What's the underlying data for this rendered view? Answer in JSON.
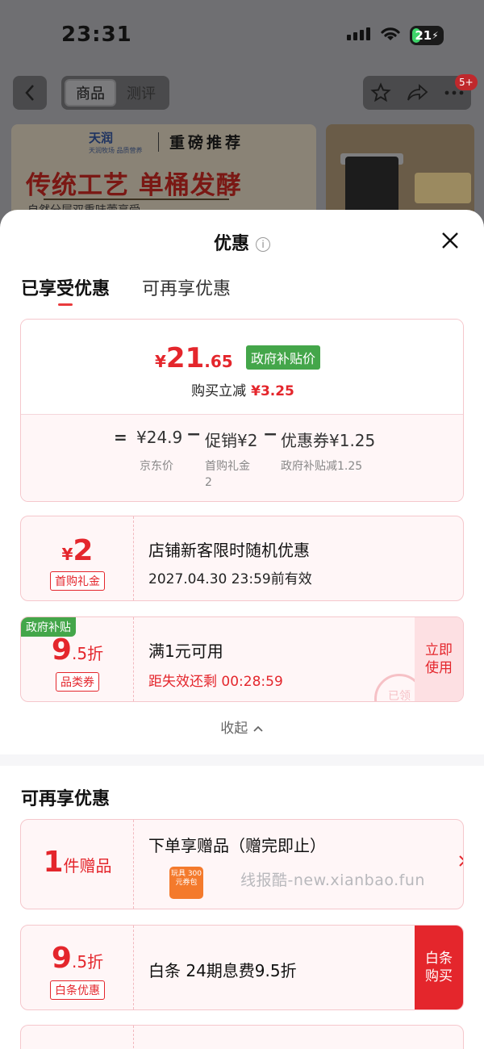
{
  "status": {
    "time": "23:31",
    "battery": "21"
  },
  "nav": {
    "tab_goods": "商品",
    "tab_review": "测评",
    "badge": "5+"
  },
  "banner": {
    "brand_name": "天润",
    "brand_sub": "天润牧场 品质营养",
    "tag": "重磅推荐",
    "headline": "传统工艺 单桶发酵",
    "sub": "自然分层双重味蕾享受"
  },
  "sheet": {
    "title": "优惠",
    "tabs": [
      "已享受优惠",
      "可再享优惠"
    ]
  },
  "price": {
    "currency": "¥",
    "int": "21",
    "dec": ".65",
    "gov_tag": "政府补贴价",
    "reduce_label": "购买立减",
    "reduce_amount": "¥3.25",
    "eq": "=",
    "jd_price": "¥24.9",
    "jd_label": "京东价",
    "promo": "促销¥2",
    "promo_label": "首购礼金",
    "promo_label2": "2",
    "coupon": "优惠券¥1.25",
    "coupon_label": "政府补贴减1.25"
  },
  "coupons_enjoyed": [
    {
      "value_cur": "¥",
      "value": "2",
      "label": "首购礼金",
      "title": "店铺新客限时随机优惠",
      "sub": "2027.04.30 23:59前有效"
    },
    {
      "corner": "政府补贴",
      "value": "9",
      "value_small": ".5折",
      "label": "品类券",
      "title": "满1元可用",
      "red": "距失效还剩 00:28:59",
      "btn": "立即使用",
      "stamp": "已领"
    }
  ],
  "collapse": "收起",
  "more_title": "可再享优惠",
  "coupons_more": [
    {
      "value": "1",
      "value_small": "件赠品",
      "title": "下单享赠品（赠完即止）",
      "gift_text": "玩具 300元券包"
    },
    {
      "value": "9",
      "value_small": ".5折",
      "label": "白条优惠",
      "title": "白条 24期息费9.5折",
      "btn": "白条购买"
    }
  ],
  "watermark": "线报酷-new.xianbao.fun",
  "colors": {
    "accent": "#e4262c",
    "gov_green": "#44a64a"
  }
}
